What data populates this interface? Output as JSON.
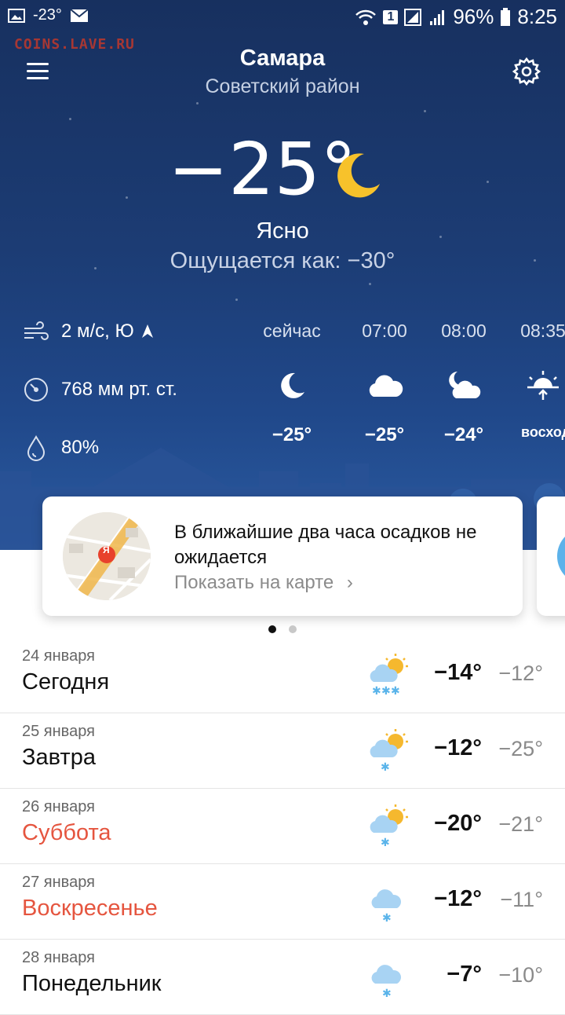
{
  "status_bar": {
    "notif_temp": "-23°",
    "battery": "96%",
    "time": "8:25",
    "sim": "1"
  },
  "watermark": "COINS.LAVE.RU",
  "header": {
    "city": "Самара",
    "district": "Советский район"
  },
  "current": {
    "temp": "−25°",
    "condition": "Ясно",
    "feels_like": "Ощущается как: −30°",
    "icon": "moon-icon"
  },
  "details": {
    "wind": "2 м/с, Ю",
    "pressure": "768 мм рт. ст.",
    "humidity": "80%"
  },
  "hourly": [
    {
      "time": "сейчас",
      "icon": "moon-icon",
      "temp": "−25°"
    },
    {
      "time": "07:00",
      "icon": "cloud-icon",
      "temp": "−25°"
    },
    {
      "time": "08:00",
      "icon": "moon-cloud-icon",
      "temp": "−24°"
    },
    {
      "time": "08:35",
      "icon": "sunrise-icon",
      "temp": "восход"
    }
  ],
  "nowcast_card": {
    "text": "В ближайшие два часа осадков не ожидается",
    "link": "Показать на карте",
    "map_badge": "Я"
  },
  "forecast": [
    {
      "date": "24 января",
      "day": "Сегодня",
      "weekend": false,
      "icon": "partly-cloudy-heavy-snow-icon",
      "high": "−14°",
      "low": "−12°"
    },
    {
      "date": "25 января",
      "day": "Завтра",
      "weekend": false,
      "icon": "partly-cloudy-snow-icon",
      "high": "−12°",
      "low": "−25°"
    },
    {
      "date": "26 января",
      "day": "Суббота",
      "weekend": true,
      "icon": "partly-cloudy-snow-icon",
      "high": "−20°",
      "low": "−21°"
    },
    {
      "date": "27 января",
      "day": "Воскресенье",
      "weekend": true,
      "icon": "cloud-snow-icon",
      "high": "−12°",
      "low": "−11°"
    },
    {
      "date": "28 января",
      "day": "Понедельник",
      "weekend": false,
      "icon": "cloud-snow-icon",
      "high": "−7°",
      "low": "−10°"
    }
  ],
  "colors": {
    "accent_weekend": "#e5553f",
    "hero_bg": "#1c3c74",
    "moon": "#f7c22b",
    "sun": "#f5b82e",
    "cloud_light": "#a8d3f3",
    "snow": "#5ab4ea"
  }
}
